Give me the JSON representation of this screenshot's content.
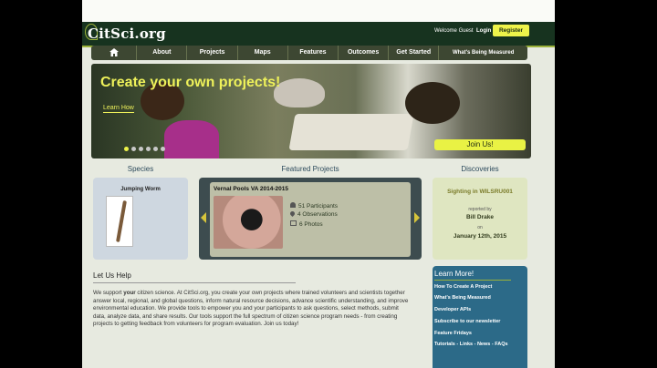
{
  "header": {
    "logo": "CitSci.org",
    "welcome": "Welcome Guest",
    "login": "Login",
    "register": "Register"
  },
  "nav": {
    "home_icon": "home-icon",
    "items": [
      "About",
      "Projects",
      "Maps",
      "Features",
      "Outcomes",
      "Get Started",
      "What's Being Measured"
    ]
  },
  "hero": {
    "title": "Create your own projects!",
    "learn_how": "Learn How",
    "join": "Join Us!",
    "slides": 6,
    "active_slide": 1
  },
  "species": {
    "title": "Species",
    "name": "Jumping Worm"
  },
  "featured": {
    "title": "Featured Projects",
    "project_title": "Vernal Pools VA 2014-2015",
    "participants": "51 Participants",
    "observations": "4 Observations",
    "photos": "6 Photos"
  },
  "discoveries": {
    "title": "Discoveries",
    "sighting": "Sighting in WILSRU001",
    "reported_by": "reported by",
    "reporter": "Bill Drake",
    "on": "on",
    "date": "January 12th, 2015"
  },
  "help": {
    "title": "Let Us Help",
    "text_pre": "We support ",
    "text_em": "your",
    "text_post": " citizen science. At CitSci.org, you create your own projects where trained volunteers and scientists together answer local, regional, and global questions, inform natural resource decisions, advance scientific understanding, and improve environmental education. We provide tools to empower you and your participants to ask questions, select methods, submit data, analyze data, and share results. Our tools support the full spectrum of citizen science program needs - from creating projects to getting feedback from volunteers for program evaluation. Join us today!"
  },
  "learn_more": {
    "title": "Learn More!",
    "items": [
      "How To Create A Project",
      "What's Being Measured",
      "Developer APIs",
      "Subscribe to our newsletter",
      "Feature Fridays",
      "Tutorials - Links - News - FAQs"
    ]
  },
  "colors": {
    "header_bg": "#17331f",
    "accent_yellow": "#eef34a",
    "nav_bg": "#3d4732",
    "learn_more_bg": "#2c6a88"
  }
}
